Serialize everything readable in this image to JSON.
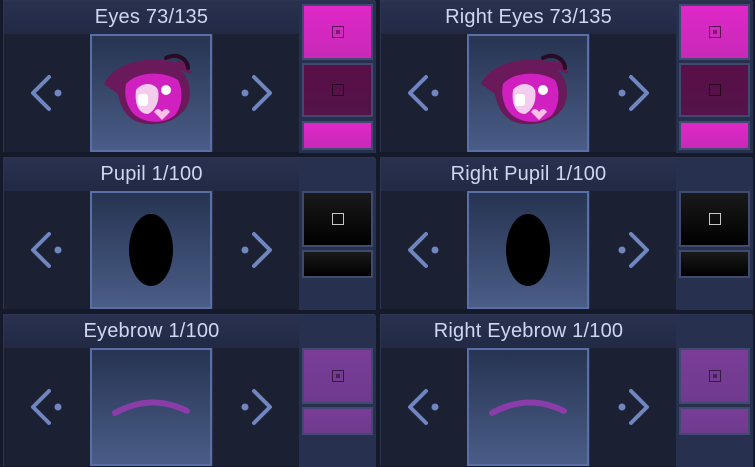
{
  "panels": [
    {
      "id": "eyes",
      "title": "Eyes 73/135",
      "preview": "eye",
      "swatches": [
        {
          "color": "#e028c8",
          "icon": "square-dot"
        },
        {
          "color": "#5a0f48",
          "icon": "square"
        },
        {
          "color": "#e028c8",
          "icon": "none"
        }
      ]
    },
    {
      "id": "right-eyes",
      "title": "Right Eyes 73/135",
      "preview": "eye",
      "swatches": [
        {
          "color": "#e028c8",
          "icon": "square-dot"
        },
        {
          "color": "#5a0f48",
          "icon": "square"
        },
        {
          "color": "#e028c8",
          "icon": "none"
        }
      ]
    },
    {
      "id": "pupil",
      "title": "Pupil 1/100",
      "preview": "pupil",
      "swatches": [
        {
          "color": "#000000",
          "icon": "square"
        },
        {
          "color": "#000000",
          "icon": "none"
        }
      ]
    },
    {
      "id": "right-pupil",
      "title": "Right Pupil 1/100",
      "preview": "pupil",
      "swatches": [
        {
          "color": "#000000",
          "icon": "square"
        },
        {
          "color": "#000000",
          "icon": "none"
        }
      ]
    },
    {
      "id": "eyebrow",
      "title": "Eyebrow 1/100",
      "preview": "eyebrow",
      "swatches": [
        {
          "color": "#7a3c98",
          "icon": "square-dot"
        },
        {
          "color": "#7a3c98",
          "icon": "none"
        }
      ]
    },
    {
      "id": "right-eyebrow",
      "title": "Right Eyebrow 1/100",
      "preview": "eyebrow",
      "swatches": [
        {
          "color": "#7a3c98",
          "icon": "square-dot"
        },
        {
          "color": "#7a3c98",
          "icon": "none"
        }
      ]
    }
  ],
  "colors": {
    "arrow": "#6f86c0",
    "eye_iris": "#d020c0",
    "eye_dark": "#6a1a5a",
    "eyebrow_stroke": "#8a3ca8",
    "pupil": "#000000"
  }
}
